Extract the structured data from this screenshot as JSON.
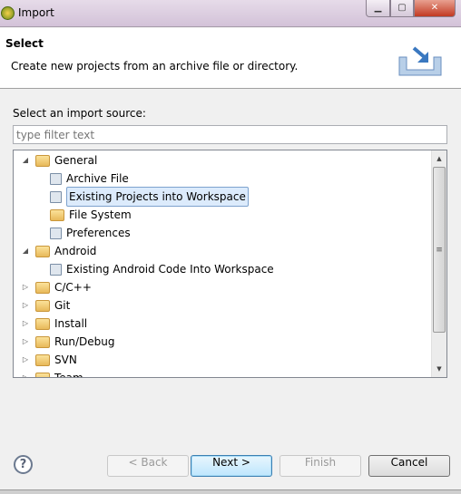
{
  "window": {
    "title": "Import",
    "controls": [
      "minimize",
      "maximize",
      "close"
    ]
  },
  "header": {
    "title": "Select",
    "description": "Create new projects from an archive file or directory.",
    "icon": "import-icon"
  },
  "source_label": "Select an import source:",
  "filter": {
    "value": "",
    "placeholder": "type filter text"
  },
  "tree": [
    {
      "label": "General",
      "level": 0,
      "expanded": true,
      "icon": "folder-open-icon"
    },
    {
      "label": "Archive File",
      "level": 1,
      "icon": "archive-icon"
    },
    {
      "label": "Existing Projects into Workspace",
      "level": 1,
      "icon": "projects-icon",
      "selected": true
    },
    {
      "label": "File System",
      "level": 1,
      "icon": "folder-icon"
    },
    {
      "label": "Preferences",
      "level": 1,
      "icon": "preferences-icon"
    },
    {
      "label": "Android",
      "level": 0,
      "expanded": true,
      "icon": "folder-open-icon"
    },
    {
      "label": "Existing Android Code Into Workspace",
      "level": 1,
      "icon": "android-project-icon"
    },
    {
      "label": "C/C++",
      "level": 0,
      "expanded": false,
      "icon": "folder-open-icon"
    },
    {
      "label": "Git",
      "level": 0,
      "expanded": false,
      "icon": "folder-open-icon"
    },
    {
      "label": "Install",
      "level": 0,
      "expanded": false,
      "icon": "folder-open-icon"
    },
    {
      "label": "Run/Debug",
      "level": 0,
      "expanded": false,
      "icon": "folder-open-icon"
    },
    {
      "label": "SVN",
      "level": 0,
      "expanded": false,
      "icon": "folder-open-icon"
    },
    {
      "label": "Team",
      "level": 0,
      "expanded": false,
      "icon": "folder-open-icon"
    }
  ],
  "buttons": {
    "help": "?",
    "back": "< Back",
    "next": "Next >",
    "finish": "Finish",
    "cancel": "Cancel"
  }
}
